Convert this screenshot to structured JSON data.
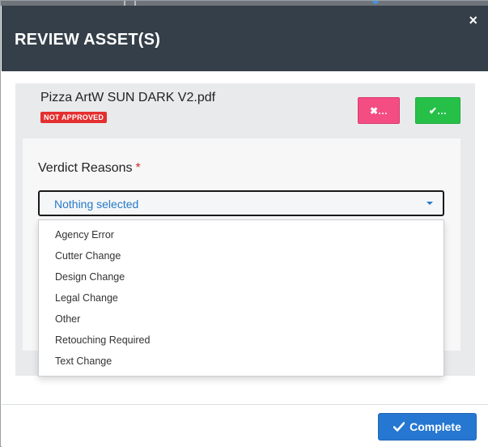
{
  "modal": {
    "title": "REVIEW ASSET(S)",
    "close_label": "×"
  },
  "asset": {
    "name": "Pizza ArtW SUN DARK V2.pdf",
    "status": "NOT APPROVED",
    "reject_label": "✖…",
    "approve_label": "✔…"
  },
  "verdict": {
    "label": "Verdict Reasons",
    "required_mark": "*",
    "selected": "Nothing selected",
    "options": [
      "Agency Error",
      "Cutter Change",
      "Design Change",
      "Legal Change",
      "Other",
      "Retouching Required",
      "Text Change"
    ]
  },
  "footer": {
    "complete_label": "Complete"
  },
  "colors": {
    "header_bg": "#343f49",
    "reject": "#f44d83",
    "approve": "#26c048",
    "primary": "#2577d1",
    "status_badge": "#e42f2f",
    "select_text": "#2579c9"
  }
}
